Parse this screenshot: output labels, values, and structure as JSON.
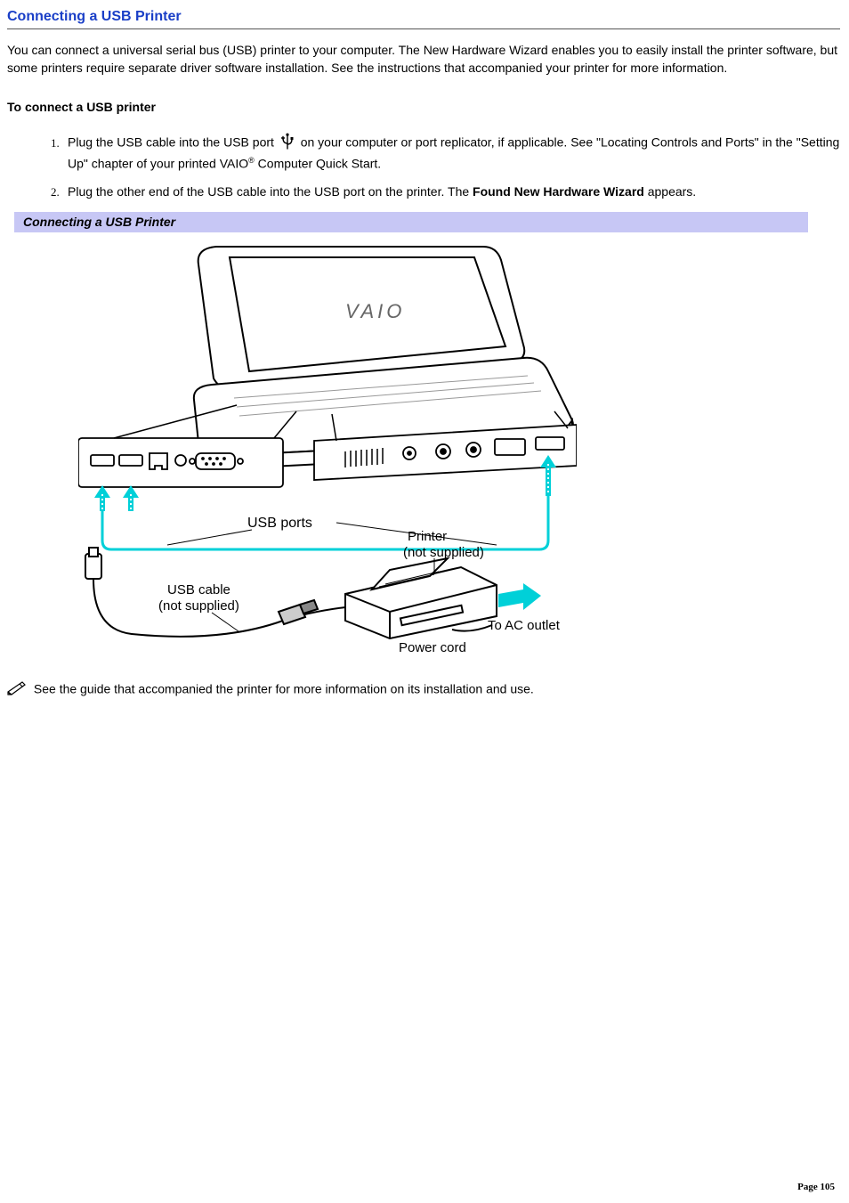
{
  "title": "Connecting a USB Printer",
  "intro": "You can connect a universal serial bus (USB) printer to your computer. The New Hardware Wizard enables you to easily install the printer software, but some printers require separate driver software installation. See the instructions that accompanied your printer for more information.",
  "subhead": "To connect a USB printer",
  "steps": {
    "s1_a": "Plug the USB cable into the USB port ",
    "s1_b": " on your computer or port replicator, if applicable. See \"Locating Controls and Ports\" in the \"Setting Up\" chapter of your printed VAIO",
    "s1_c": " Computer Quick Start.",
    "s2_a": "Plug the other end of the USB cable into the USB port on the printer. The ",
    "s2_bold": "Found New Hardware Wizard",
    "s2_b": " appears."
  },
  "figure_caption": "Connecting a USB Printer",
  "diagram": {
    "usb_ports": "USB ports",
    "printer": "Printer",
    "printer_sub": "(not supplied)",
    "usb_cable": "USB cable",
    "usb_cable_sub": "(not supplied)",
    "ac_outlet": "To AC outlet",
    "power_cord": "Power cord"
  },
  "note": "See the guide that accompanied the printer for more information on its installation and use.",
  "page_label": "Page 105",
  "reg_mark": "®"
}
